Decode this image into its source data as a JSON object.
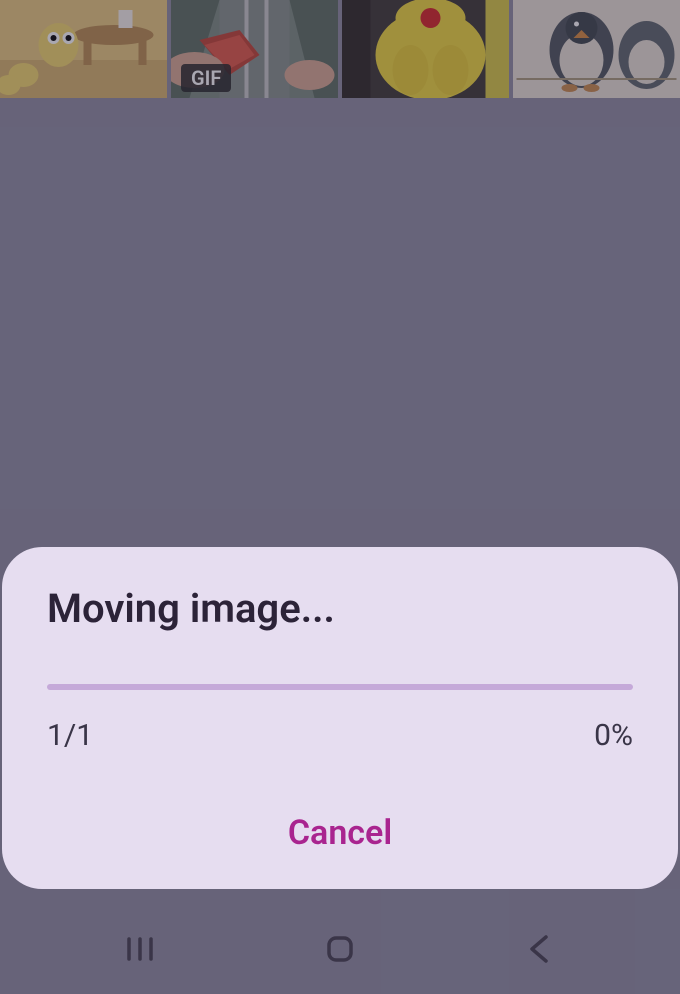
{
  "gallery": {
    "items": [
      {
        "gif_badge": null
      },
      {
        "gif_badge": "GIF"
      },
      {
        "gif_badge": null
      },
      {
        "gif_badge": null
      }
    ]
  },
  "dialog": {
    "title": "Moving image...",
    "count": "1/1",
    "percent": "0%",
    "cancel_label": "Cancel"
  },
  "navbar": {
    "recents": "recents",
    "home": "home",
    "back": "back"
  }
}
